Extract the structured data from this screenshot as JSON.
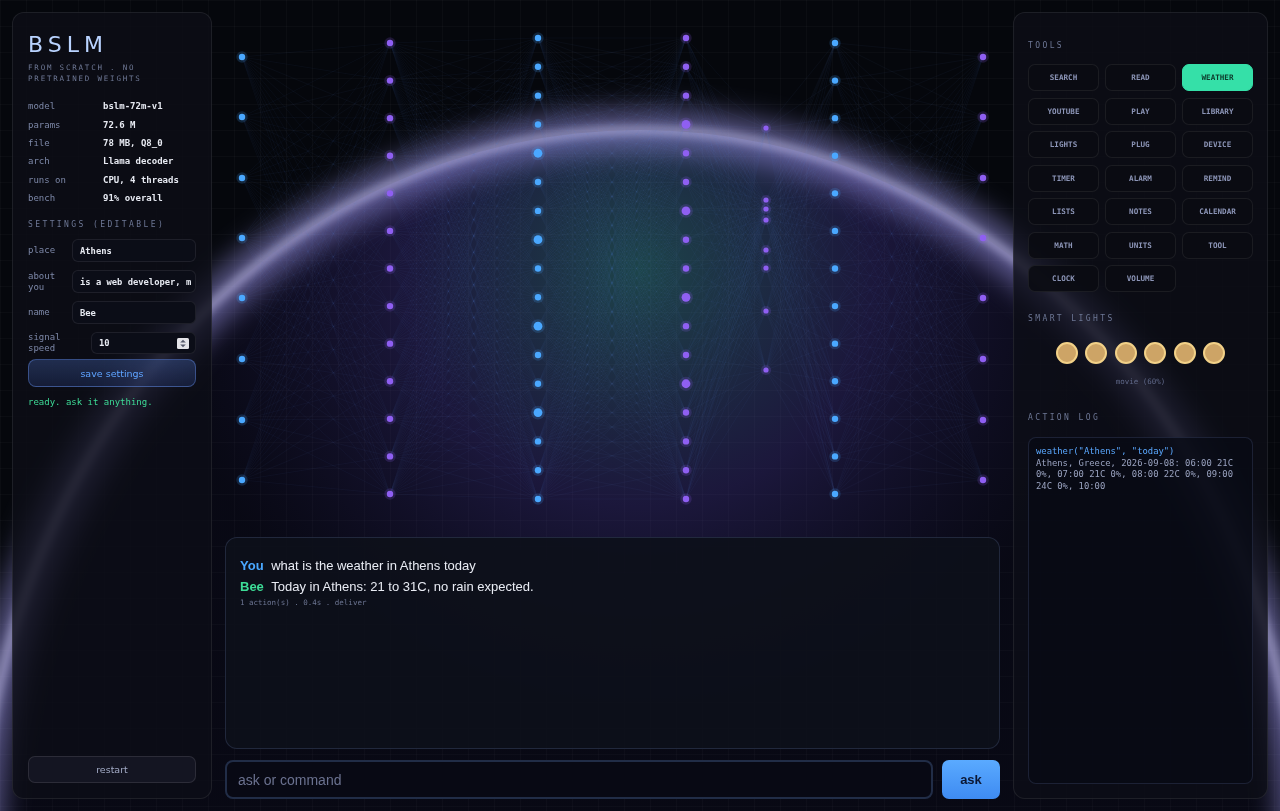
{
  "brand": {
    "title": "BSLM",
    "subtitle": "FROM SCRATCH . NO PRETRAINED WEIGHTS"
  },
  "model_info": [
    {
      "label": "model",
      "value": "bslm-72m-v1"
    },
    {
      "label": "params",
      "value": "72.6 M"
    },
    {
      "label": "file",
      "value": "78 MB, Q8_0"
    },
    {
      "label": "arch",
      "value": "Llama decoder"
    },
    {
      "label": "runs on",
      "value": "CPU, 4 threads"
    },
    {
      "label": "bench",
      "value": "91% overall"
    }
  ],
  "settings": {
    "heading": "SETTINGS (EDITABLE)",
    "fields": [
      {
        "label": "place",
        "value": "Athens",
        "kind": "text"
      },
      {
        "label": "about you",
        "value": "is a web developer, m",
        "kind": "text"
      },
      {
        "label": "name",
        "value": "Bee",
        "kind": "text"
      },
      {
        "label": "signal speed",
        "value": "10",
        "kind": "number"
      }
    ],
    "save_button": "save settings",
    "status": "ready. ask it anything."
  },
  "restart_button": "restart",
  "chat": {
    "messages": [
      {
        "speaker": "You",
        "color": "#4aa8ff",
        "text": "what is the weather in Athens today"
      },
      {
        "speaker": "Bee",
        "color": "#3ddc97",
        "text": "Today in Athens: 21 to 31C, no rain expected.",
        "meta": "1 action(s) . 0.4s . deliver"
      }
    ]
  },
  "input": {
    "placeholder": "ask or command",
    "button": "ask"
  },
  "tools": {
    "heading": "TOOLS",
    "items": [
      {
        "label": "SEARCH",
        "selected": false
      },
      {
        "label": "READ",
        "selected": false
      },
      {
        "label": "WEATHER",
        "selected": true
      },
      {
        "label": "YOUTUBE",
        "selected": false
      },
      {
        "label": "PLAY",
        "selected": false
      },
      {
        "label": "LIBRARY",
        "selected": false
      },
      {
        "label": "LIGHTS",
        "selected": false
      },
      {
        "label": "PLUG",
        "selected": false
      },
      {
        "label": "DEVICE",
        "selected": false
      },
      {
        "label": "TIMER",
        "selected": false
      },
      {
        "label": "ALARM",
        "selected": false
      },
      {
        "label": "REMIND",
        "selected": false
      },
      {
        "label": "LISTS",
        "selected": false
      },
      {
        "label": "NOTES",
        "selected": false
      },
      {
        "label": "CALENDAR",
        "selected": false
      },
      {
        "label": "MATH",
        "selected": false
      },
      {
        "label": "UNITS",
        "selected": false
      },
      {
        "label": "TOOL",
        "selected": false
      },
      {
        "label": "CLOCK",
        "selected": false
      },
      {
        "label": "VOLUME",
        "selected": false
      }
    ]
  },
  "smart_lights": {
    "heading": "SMART LIGHTS",
    "lights": [
      {
        "on": true
      },
      {
        "on": true
      },
      {
        "on": true
      },
      {
        "on": true
      },
      {
        "on": true
      },
      {
        "on": true
      }
    ],
    "caption": "movie (60%)"
  },
  "action_log": {
    "heading": "ACTION LOG",
    "entries": [
      {
        "call": "weather(\"Athens\", \"today\")",
        "result": "Athens, Greece, 2026-09-08: 06:00 21C 0%, 07:00 21C 0%, 08:00 22C 0%, 09:00 24C 0%, 10:00"
      }
    ]
  }
}
